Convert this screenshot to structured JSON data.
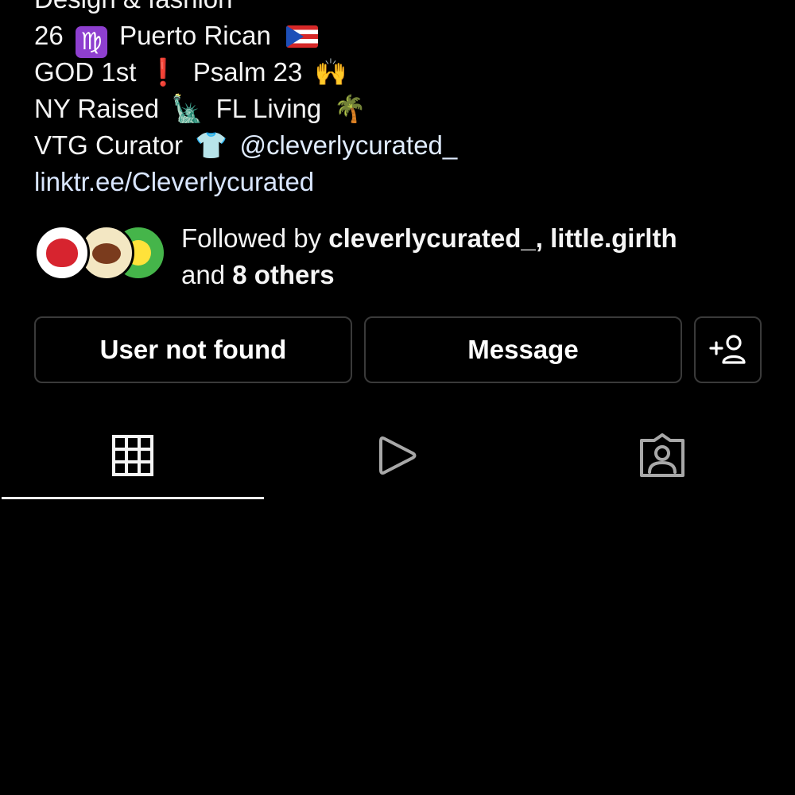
{
  "bio": {
    "partial_line": "Design & fashion",
    "age": "26",
    "virgo_emoji": "♍",
    "origin": "Puerto Rican",
    "faith_a": "GOD 1st",
    "faith_bang": "❗",
    "faith_b": "Psalm 23",
    "faith_emoji": "🙌",
    "raised": "NY Raised",
    "statue_emoji": "🗽",
    "living": "FL Living",
    "palm_emoji": "🌴",
    "curator": "VTG Curator",
    "shirt_emoji": "👕",
    "mention": "@cleverlycurated_",
    "link": "linktr.ee/Cleverlycurated"
  },
  "followed_by": {
    "prefix": "Followed by",
    "names": "cleverlycurated_, little.girlth",
    "and": "and",
    "others": "8 others"
  },
  "buttons": {
    "user_not_found": "User not found",
    "message": "Message"
  },
  "icons": {
    "add_user": "add-user-icon",
    "grid": "grid-icon",
    "reels": "reels-icon",
    "tagged": "tagged-icon"
  },
  "colors": {
    "background": "#000000",
    "text": "#f5f5f5",
    "link": "#d9e6ff",
    "button_border": "#3a3a3a",
    "active_tab_underline": "#f5f5f5"
  }
}
